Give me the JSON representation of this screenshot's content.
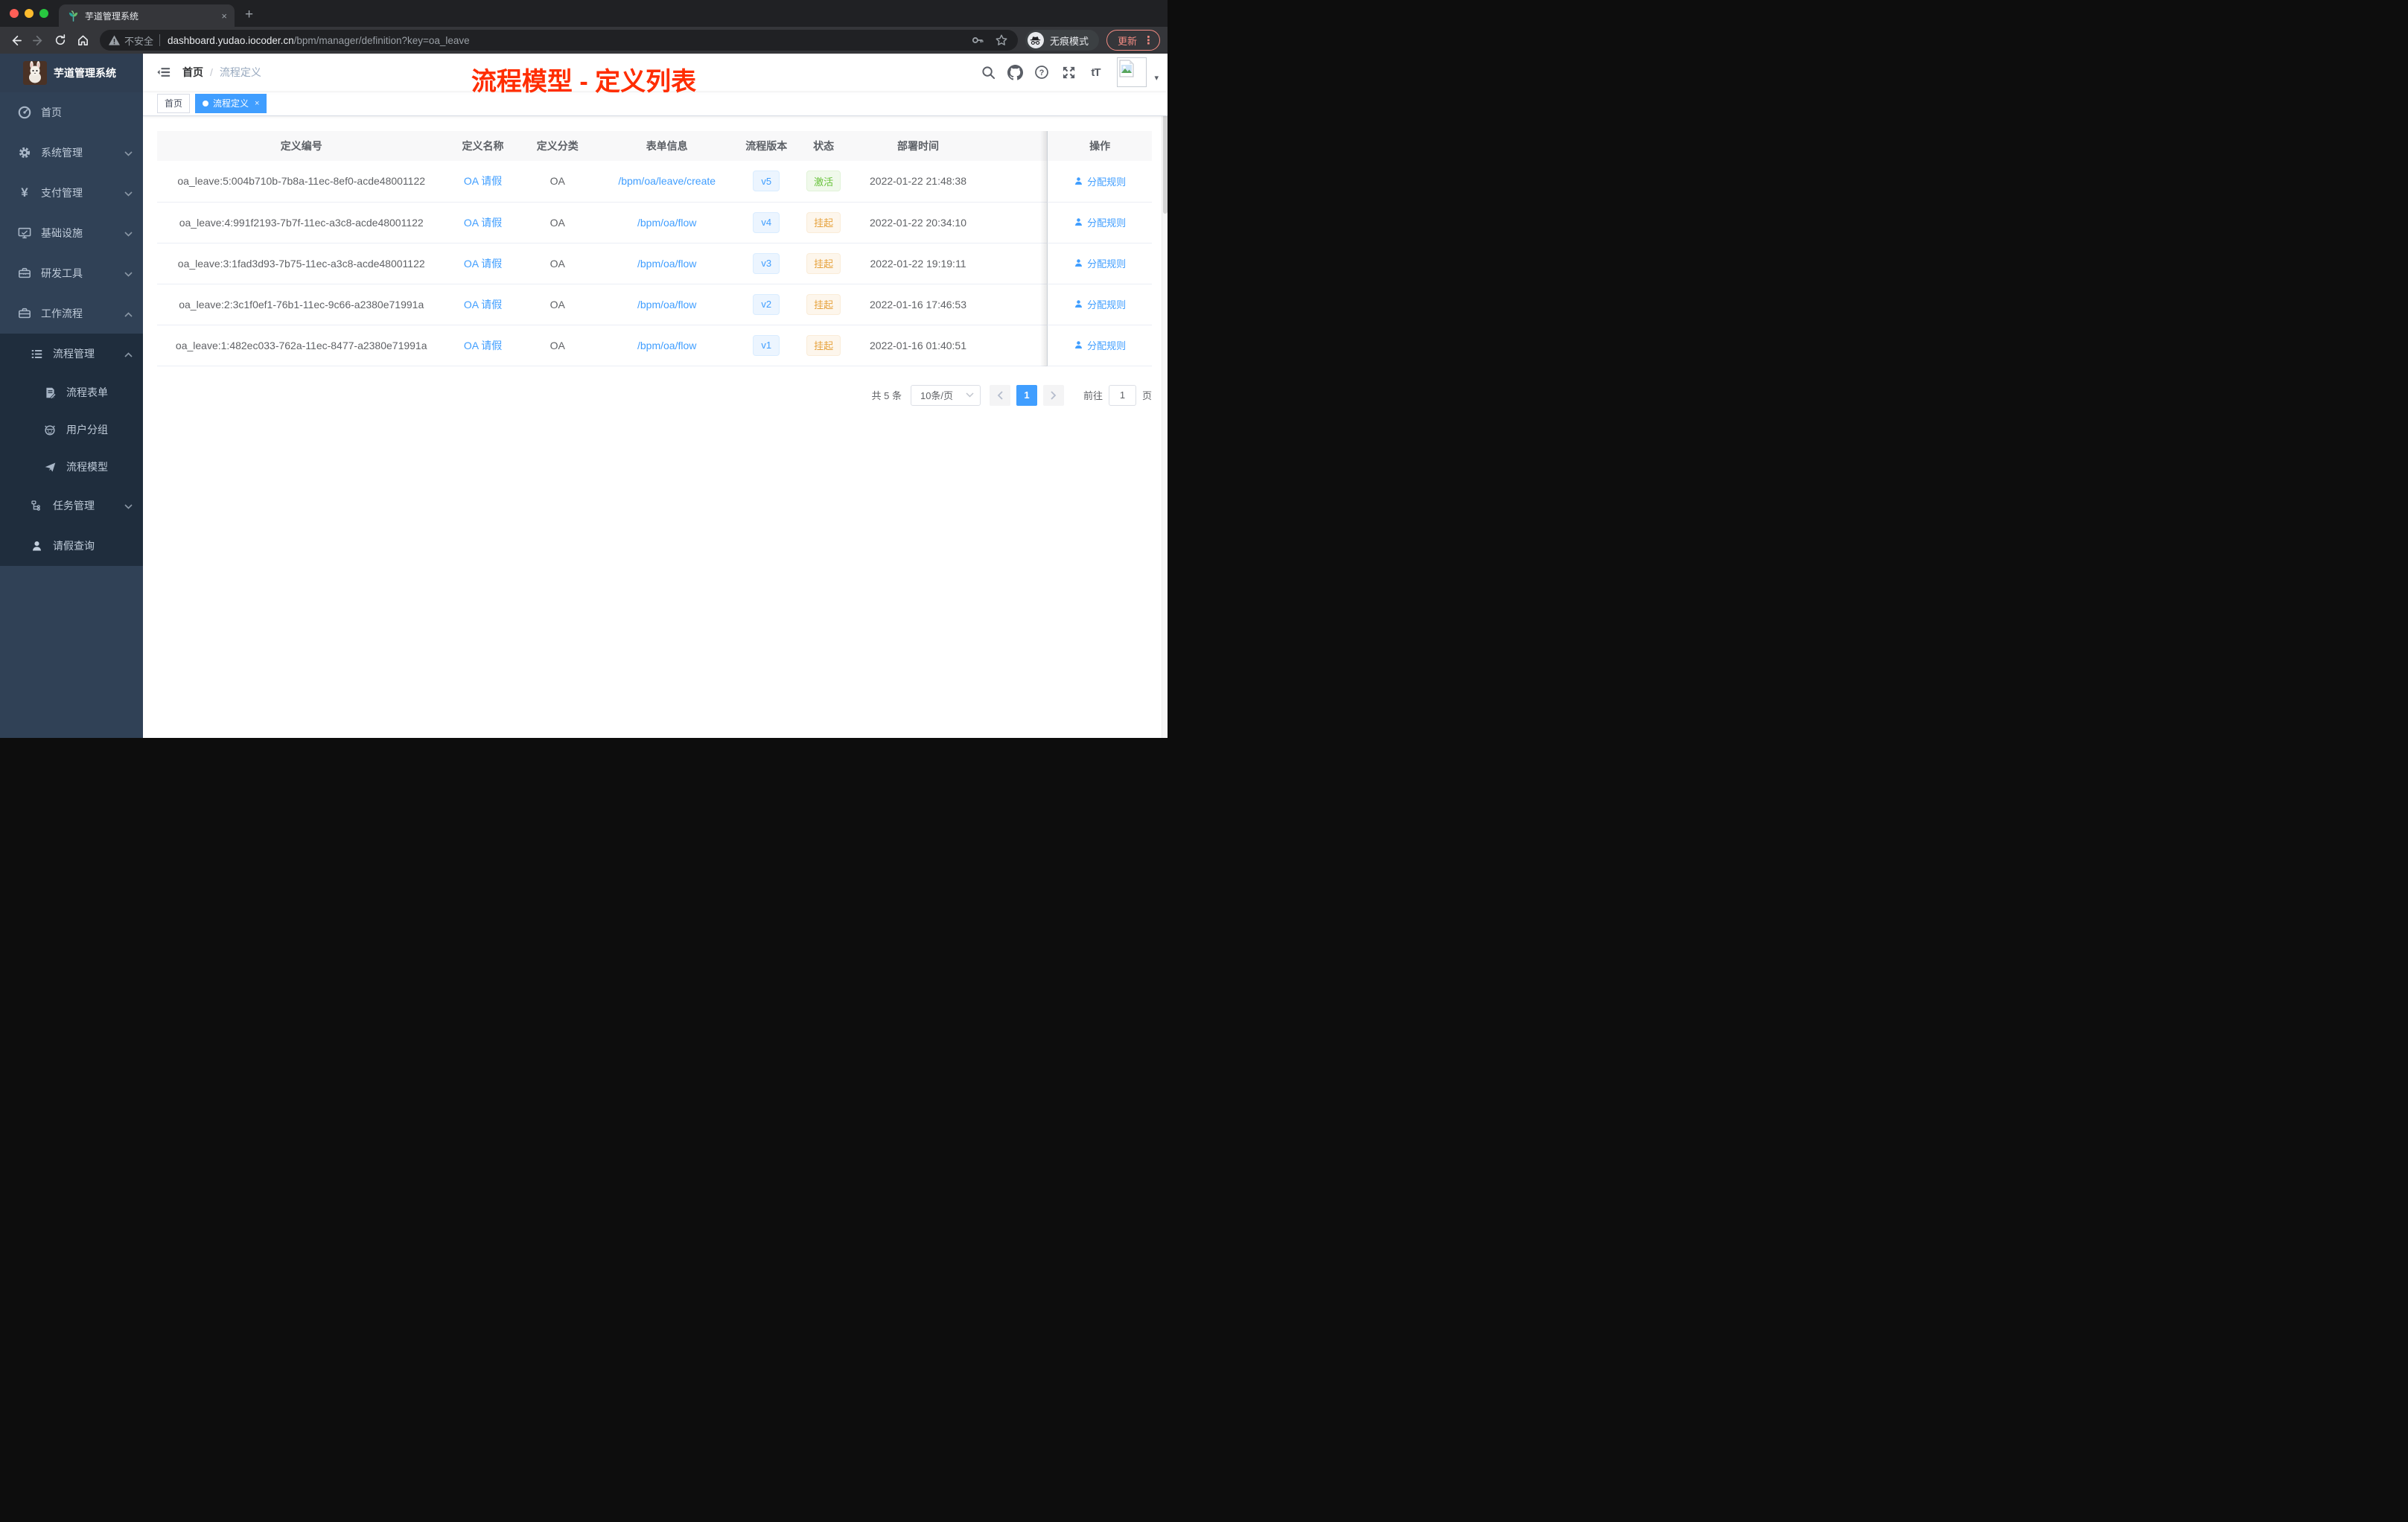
{
  "glyphs": {
    "close": "×",
    "plus": "+",
    "dots": "⋮",
    "caret_down": "▾",
    "font_size": "tT"
  },
  "colors": {
    "primary": "#409eff",
    "success": "#67c23a",
    "warning": "#e6a23c",
    "annotation": "#ff2d00",
    "sidebar": "#304156"
  },
  "browser": {
    "tab": {
      "title": "芋道管理系统"
    },
    "toolbar": {
      "security": "不安全",
      "url_host": "dashboard.yudao.iocoder.cn",
      "url_path": "/bpm/manager/definition?key=oa_leave",
      "incognito": "无痕模式",
      "update": "更新"
    }
  },
  "app": {
    "logo_title": "芋道管理系统",
    "sidebar": {
      "items": [
        {
          "label": "首页",
          "icon": "dashboard-icon"
        },
        {
          "label": "系统管理",
          "icon": "gear-icon"
        },
        {
          "label": "支付管理",
          "icon": "yuan-icon"
        },
        {
          "label": "基础设施",
          "icon": "monitor-icon"
        },
        {
          "label": "研发工具",
          "icon": "toolbox-icon"
        },
        {
          "label": "工作流程",
          "icon": "briefcase-icon"
        }
      ],
      "process_group": {
        "label": "流程管理",
        "icon": "list-icon",
        "children": [
          {
            "label": "流程表单",
            "icon": "form-edit-icon"
          },
          {
            "label": "用户分组",
            "icon": "user-group-icon"
          },
          {
            "label": "流程模型",
            "icon": "paper-plane-icon"
          }
        ]
      },
      "task": {
        "label": "任务管理",
        "icon": "tree-icon"
      },
      "leave": {
        "label": "请假查询",
        "icon": "person-icon"
      }
    },
    "navbar": {
      "breadcrumb": {
        "home": "首页",
        "sep": "/",
        "current": "流程定义"
      }
    },
    "annotation": {
      "text": "流程模型 - 定义列表"
    },
    "tags": {
      "home": "首页",
      "current": "流程定义"
    }
  },
  "table": {
    "columns": [
      "定义编号",
      "定义名称",
      "定义分类",
      "表单信息",
      "流程版本",
      "状态",
      "部署时间",
      "操作"
    ],
    "rows": [
      {
        "id": "oa_leave:5:004b710b-7b8a-11ec-8ef0-acde48001122",
        "name": "OA 请假",
        "category": "OA",
        "form": "/bpm/oa/leave/create",
        "version": "v5",
        "status": "激活",
        "status_type": "success",
        "deployed": "2022-01-22 21:48:38",
        "action": "分配规则"
      },
      {
        "id": "oa_leave:4:991f2193-7b7f-11ec-a3c8-acde48001122",
        "name": "OA 请假",
        "category": "OA",
        "form": "/bpm/oa/flow",
        "version": "v4",
        "status": "挂起",
        "status_type": "warning",
        "deployed": "2022-01-22 20:34:10",
        "action": "分配规则"
      },
      {
        "id": "oa_leave:3:1fad3d93-7b75-11ec-a3c8-acde48001122",
        "name": "OA 请假",
        "category": "OA",
        "form": "/bpm/oa/flow",
        "version": "v3",
        "status": "挂起",
        "status_type": "warning",
        "deployed": "2022-01-22 19:19:11",
        "action": "分配规则"
      },
      {
        "id": "oa_leave:2:3c1f0ef1-76b1-11ec-9c66-a2380e71991a",
        "name": "OA 请假",
        "category": "OA",
        "form": "/bpm/oa/flow",
        "version": "v2",
        "status": "挂起",
        "status_type": "warning",
        "deployed": "2022-01-16 17:46:53",
        "action": "分配规则"
      },
      {
        "id": "oa_leave:1:482ec033-762a-11ec-8477-a2380e71991a",
        "name": "OA 请假",
        "category": "OA",
        "form": "/bpm/oa/flow",
        "version": "v1",
        "status": "挂起",
        "status_type": "warning",
        "deployed": "2022-01-16 01:40:51",
        "action": "分配规则"
      }
    ]
  },
  "pagination": {
    "total": "共 5 条",
    "page_size": "10条/页",
    "page": "1",
    "goto": "前往",
    "goto_value": "1",
    "unit": "页"
  }
}
